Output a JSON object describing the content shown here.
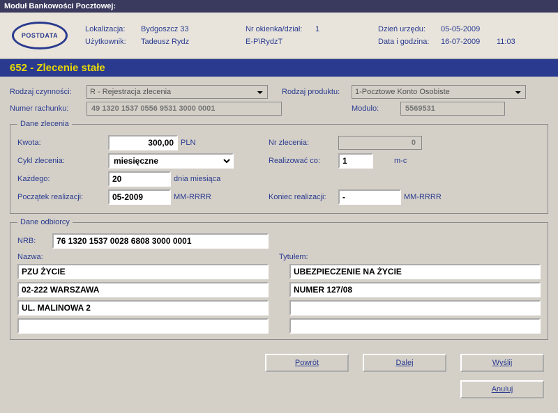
{
  "titlebar": "Moduł Bankowości Pocztowej:",
  "header": {
    "lokalizacja_lbl": "Lokalizacja:",
    "lokalizacja_val": "Bydgoszcz 33",
    "nrokienka_lbl": "Nr okienka/dział:",
    "nrokienka_val": "1",
    "dzienurzedu_lbl": "Dzień urzędu:",
    "dzienurzedu_val": "05-05-2009",
    "uzytkownik_lbl": "Użytkownik:",
    "uzytkownik_val": "Tadeusz Rydz",
    "ep_lbl": "E-P\\RydzT",
    "datagodz_lbl": "Data i godzina:",
    "datagodz_date": "16-07-2009",
    "datagodz_time": "11:03",
    "logo_text": "POSTDATA"
  },
  "subtitle": "652 - Zlecenie stałe",
  "form": {
    "rodzaj_czynnosci_lbl": "Rodzaj czynności:",
    "rodzaj_czynnosci_val": "R - Rejestracja zlecenia",
    "rodzaj_produktu_lbl": "Rodzaj produktu:",
    "rodzaj_produktu_val": "1-Pocztowe Konto Osobiste",
    "numer_rachunku_lbl": "Numer rachunku:",
    "numer_rachunku_val": "49 1320 1537 0556 9531 3000 0001",
    "modulo_lbl": "Modulo:",
    "modulo_val": "5569531"
  },
  "dane_zlecenia": {
    "legend": "Dane zlecenia",
    "kwota_lbl": "Kwota:",
    "kwota_val": "300,00",
    "kwota_unit": "PLN",
    "nr_zlecenia_lbl": "Nr zlecenia:",
    "nr_zlecenia_val": "0",
    "cykl_lbl": "Cykl zlecenia:",
    "cykl_val": "miesięczne",
    "realizowac_lbl": "Realizować co:",
    "realizowac_val": "1",
    "realizowac_unit": "m-c",
    "kazdego_lbl": "Każdego:",
    "kazdego_val": "20",
    "kazdego_unit": "dnia miesiąca",
    "poczatek_lbl": "Początek realizacji:",
    "poczatek_val": "05-2009",
    "poczatek_unit": "MM-RRRR",
    "koniec_lbl": "Koniec realizacji:",
    "koniec_val": "-",
    "koniec_unit": "MM-RRRR"
  },
  "dane_odbiorcy": {
    "legend": "Dane odbiorcy",
    "nrb_lbl": "NRB:",
    "nrb_val": "76 1320 1537 0028 6808 3000 0001",
    "nazwa_lbl": "Nazwa:",
    "tytulem_lbl": "Tytułem:",
    "nazwa": [
      "PZU ŻYCIE",
      "02-222 WARSZAWA",
      "UL. MALINOWA 2",
      ""
    ],
    "tytulem": [
      "UBEZPIECZENIE NA ŻYCIE",
      "NUMER 127/08",
      "",
      ""
    ]
  },
  "buttons": {
    "powrot": "Powrót",
    "dalej": "Dalej",
    "wyslij": "Wyślij",
    "anuluj": "Anuluj"
  }
}
